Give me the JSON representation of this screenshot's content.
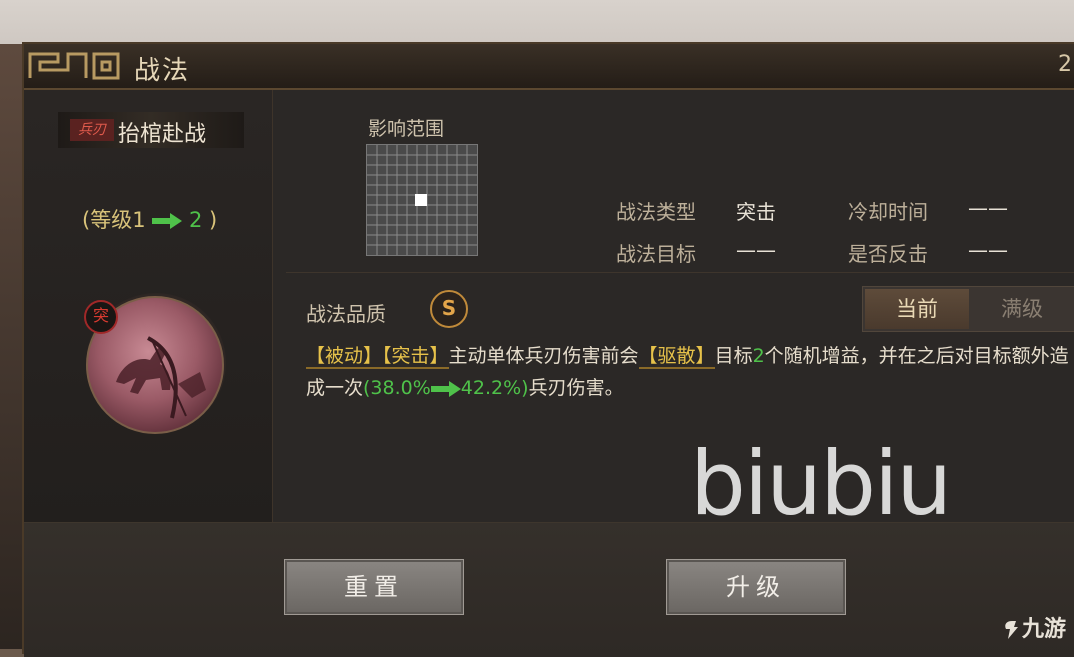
{
  "window": {
    "title": "战法",
    "close_glyph": "2"
  },
  "skill": {
    "troop_tag": "兵刃",
    "name": "抬棺赴战",
    "level_prefix": "(等级1",
    "level_to": "2",
    "level_suffix": ")",
    "emblem_badge": "突"
  },
  "range": {
    "label": "影响范围"
  },
  "info": {
    "type_label": "战法类型",
    "type_value": "突击",
    "target_label": "战法目标",
    "target_value": "——",
    "cooldown_label": "冷却时间",
    "cooldown_value": "——",
    "counter_label": "是否反击",
    "counter_value": "——"
  },
  "quality": {
    "label": "战法品质",
    "grade": "S"
  },
  "toggle": {
    "current": "当前",
    "max": "满级"
  },
  "description": {
    "kw_passive": "【被动】",
    "kw_assault": "【突击】",
    "text1": "主动单体兵刃伤害前会",
    "kw_disperse": "【驱散】",
    "text2": "目标",
    "count": "2",
    "text3": "个随机增益，并在之后对目标额外造成一次",
    "pct_open": "(38.0%",
    "pct_to": "42.2%)",
    "text4": "兵刃伤害。"
  },
  "watermark": "biubiu",
  "buttons": {
    "reset": "重置",
    "upgrade": "升级"
  },
  "corner_logo": "九游",
  "colors": {
    "accent_gold": "#e7c24a",
    "accent_green": "#4fc24a",
    "troop_red": "#e05a4c"
  }
}
